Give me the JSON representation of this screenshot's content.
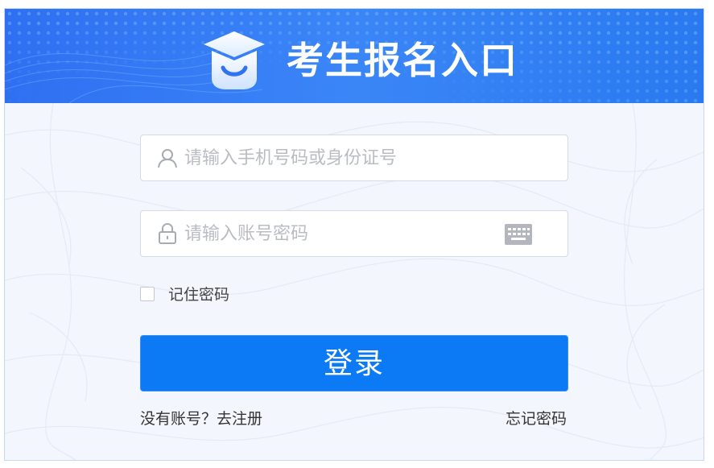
{
  "header": {
    "title": "考生报名入口",
    "logo_icon": "graduation-cap-smile-icon"
  },
  "form": {
    "username": {
      "icon": "user-icon",
      "placeholder": "请输入手机号码或身份证号",
      "value": ""
    },
    "password": {
      "icon": "lock-icon",
      "placeholder": "请输入账号密码",
      "value": "",
      "keyboard_icon": "keyboard-icon"
    },
    "remember_label": "记住密码",
    "remember_checked": false,
    "login_label": "登录"
  },
  "links": {
    "register": "没有账号？去注册",
    "forgot": "忘记密码"
  },
  "colors": {
    "header_blue": "#2f6ff2",
    "button_blue": "#0c79f5",
    "page_bg": "#f3f6fc"
  }
}
